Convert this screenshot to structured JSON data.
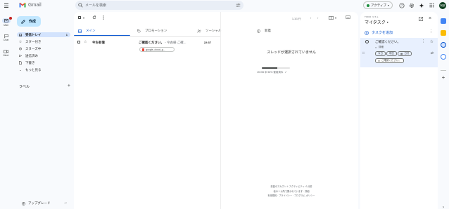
{
  "app": {
    "name": "Gmail"
  },
  "search": {
    "placeholder": "メールを検索"
  },
  "header": {
    "status": "アクティブ",
    "avatar_initials": "阿部"
  },
  "rail": {
    "mail": "Mail",
    "chat": "Chat",
    "meet": "Meet"
  },
  "nav": {
    "compose": "作成",
    "items": [
      {
        "label": "受信トレイ",
        "count": "1"
      },
      {
        "label": "スター付き"
      },
      {
        "label": "スヌーズ中"
      },
      {
        "label": "送信済み"
      },
      {
        "label": "下書き"
      },
      {
        "label": "もっと見る"
      }
    ],
    "labels_heading": "ラベル",
    "labels_add": "+",
    "upgrade": "アップグレード"
  },
  "toolbar": {
    "pager": "1-1/1 行"
  },
  "tabs": [
    {
      "label": "メイン",
      "active": true
    },
    {
      "label": "プロモーション"
    },
    {
      "label": "ソーシャル"
    },
    {
      "label": "新着"
    }
  ],
  "rows": [
    {
      "sender": "今古有偉",
      "subject": "ご確認ください。",
      "snippet": " - 今古様 ご確...",
      "time": "22:37",
      "attachment": "google_cloud_g..."
    }
  ],
  "thread_pane": {
    "empty_message": "スレッドが選択されていません",
    "storage_percent": 56,
    "storage_text": "15 GB 中 56% 使用済み",
    "footer": [
      "前回のアカウント アクティビティ: 0 分前",
      "他の 1 か所で開かれています · 詳細",
      "利用規約 · プライバシー · プログラム ポリシー"
    ]
  },
  "tasks": {
    "app_label": "TODO リスト",
    "list_title": "マイタスク",
    "add_label": "タスクを追加",
    "task": {
      "title": "ご確認ください。",
      "detail": "詳細",
      "chips": [
        "今日",
        "明日",
        "日付"
      ],
      "link": "ご確認ください。"
    }
  },
  "colors": {
    "accent": "#0b57d0",
    "compose_bg": "#c2e7ff",
    "active_nav": "#d3e3fd",
    "status_green": "#1e8e3e"
  }
}
